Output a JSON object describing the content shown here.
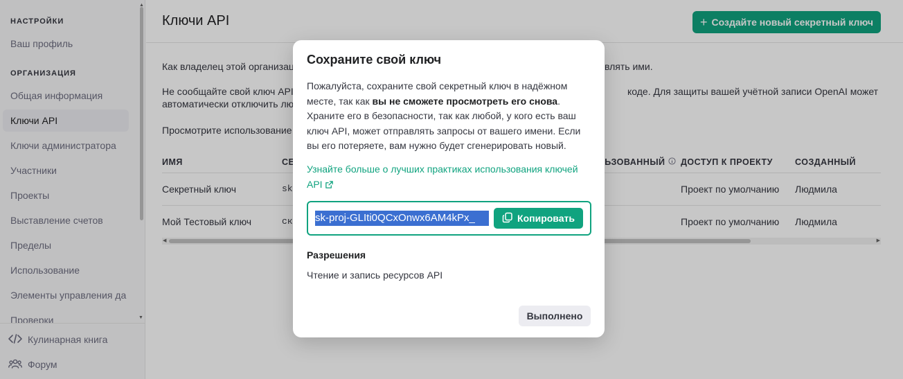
{
  "sidebar": {
    "section_settings": "НАСТРОЙКИ",
    "profile": "Ваш профиль",
    "section_org": "ОРГАНИЗАЦИЯ",
    "items": [
      "Общая информация",
      "Ключи API",
      "Ключи администратора",
      "Участники",
      "Проекты",
      "Выставление счетов",
      "Пределы",
      "Использование",
      "Элементы управления да",
      "Проверки"
    ],
    "footer": {
      "cookbook": "Кулинарная книга",
      "forum": "Форум"
    }
  },
  "header": {
    "title": "Ключи API",
    "create_button": "Создайте новый секретный ключ"
  },
  "main": {
    "para1": "Как владелец этой организац",
    "para1_end": "влять ими.",
    "para2_line1": "Не сообщайте свой ключ API д",
    "para2_line1_end": "коде. Для защиты вашей учётной записи OpenAI может",
    "para2_line2": "автоматически отключить любо",
    "para3": "Просмотрите использование к"
  },
  "table": {
    "headers": {
      "name": "ИМЯ",
      "secret": "СЕ",
      "last_used": "ЛЬЗОВАННЫЙ",
      "project_access": "ДОСТУП К ПРОЕКТУ",
      "created_by": "СОЗДАННЫЙ"
    },
    "rows": [
      {
        "name": "Секретный ключ",
        "secret": "sk",
        "project": "Проект по умолчанию",
        "created_by": "Людмила"
      },
      {
        "name": "Мой Тестовый ключ",
        "secret": "ск",
        "project": "Проект по умолчанию",
        "created_by": "Людмила"
      }
    ]
  },
  "modal": {
    "title": "Сохраните свой ключ",
    "text_before": "Пожалуйста, сохраните свой секретный ключ в надёжном месте, так как ",
    "text_bold": "вы не сможете просмотреть его снова",
    "text_after": ". Храните его в безопасности, так как любой, у кого есть ваш ключ API, может отправлять запросы от вашего имени. Если вы его потеряете, вам нужно будет сгенерировать новый.",
    "link": "Узнайте больше о лучших практиках использования ключей API",
    "key_value": "sk-proj-GLIti0QCxOnwx6AM4kPx_",
    "copy_button": "Копировать",
    "permissions_title": "Разрешения",
    "permissions_value": "Чтение и запись ресурсов API",
    "done_button": "Выполнено"
  },
  "colors": {
    "accent": "#10a37f",
    "selection": "#3b6fd1"
  }
}
